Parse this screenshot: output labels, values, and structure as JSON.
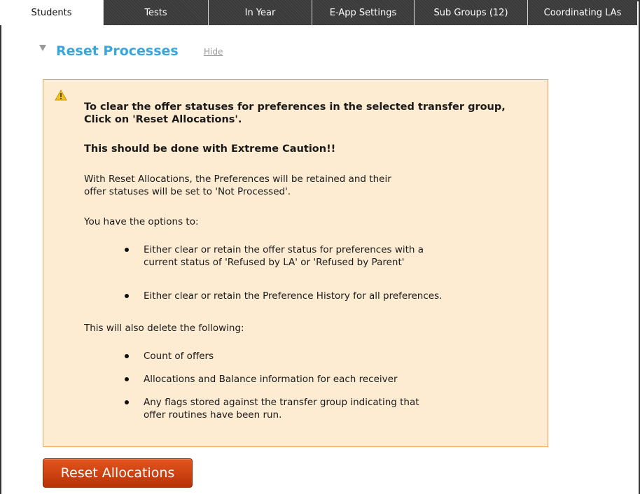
{
  "tabs": [
    {
      "label": "Students",
      "active": true
    },
    {
      "label": "Tests",
      "active": false
    },
    {
      "label": "In Year",
      "active": false
    },
    {
      "label": "E-App Settings",
      "active": false
    },
    {
      "label": "Sub Groups  (12)",
      "active": false
    },
    {
      "label": "Coordinating LAs",
      "active": false
    }
  ],
  "section": {
    "title": "Reset Processes",
    "hide_label": "Hide"
  },
  "warning": {
    "heading_line1": "To clear the offer statuses for preferences in the selected transfer group,",
    "heading_line2": "Click on 'Reset Allocations'.",
    "caution": "This should be done with Extreme Caution!!",
    "para1_line1": "With Reset Allocations, the Preferences will be retained and their",
    "para1_line2": "offer statuses will be set to 'Not Processed'.",
    "options_intro": "You have the options to:",
    "options": [
      {
        "line1": "Either clear or retain the offer status for preferences with a",
        "line2": "current status of 'Refused by LA' or 'Refused by Parent'"
      },
      {
        "line1": "Either clear or retain the Preference History for all preferences.",
        "line2": ""
      }
    ],
    "delete_intro": "This will also delete the following:",
    "deletes": [
      {
        "line1": "Count of offers",
        "line2": ""
      },
      {
        "line1": "Allocations and Balance information for each receiver",
        "line2": ""
      },
      {
        "line1": "Any flags stored against the transfer group indicating that",
        "line2": "offer routines have been run."
      }
    ]
  },
  "button": {
    "label": "Reset Allocations"
  },
  "colors": {
    "title": "#3aa6dc",
    "warning_bg": "#fdebd2",
    "warning_border": "#f2a15c",
    "button": "#c9400f",
    "tab_dark": "#3a3a3a"
  }
}
